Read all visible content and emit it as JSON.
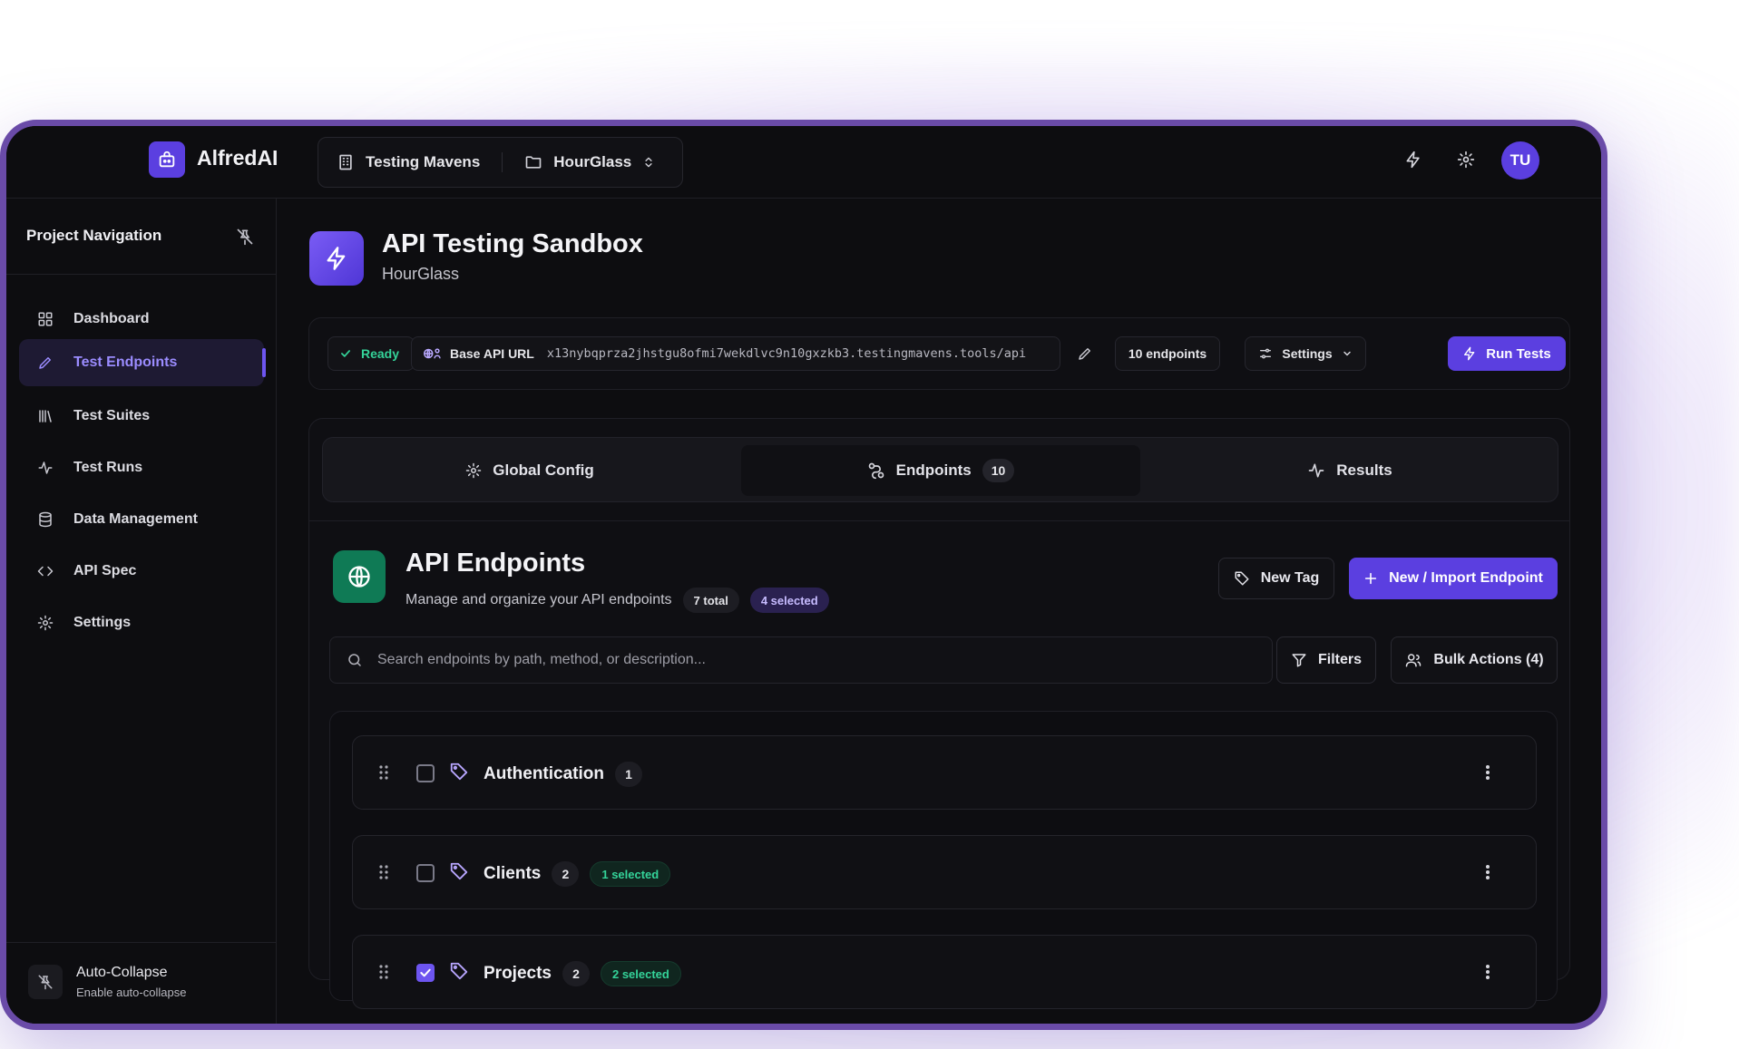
{
  "app": {
    "brand": "AlfredAI",
    "avatar_initials": "TU",
    "accent": "#5b3fe0"
  },
  "switcher": {
    "org": "Testing Mavens",
    "project": "HourGlass"
  },
  "sidebar": {
    "title": "Project Navigation",
    "items": [
      {
        "label": "Dashboard",
        "icon": "grid-icon"
      },
      {
        "label": "Test Endpoints",
        "icon": "pencil-icon",
        "active": true
      },
      {
        "label": "Test Suites",
        "icon": "library-icon"
      },
      {
        "label": "Test Runs",
        "icon": "activity-icon"
      },
      {
        "label": "Data Management",
        "icon": "database-icon"
      },
      {
        "label": "API Spec",
        "icon": "code-icon"
      },
      {
        "label": "Settings",
        "icon": "gear-icon"
      }
    ],
    "footer": {
      "title": "Auto-Collapse",
      "subtitle": "Enable auto-collapse"
    }
  },
  "project": {
    "title": "API Testing Sandbox",
    "subtitle": "HourGlass"
  },
  "status": {
    "ready": "Ready",
    "base_url_label": "Base API URL",
    "base_url": "x13nybqprza2jhstgu8ofmi7wekdlvc9n10gxzkb3.testingmavens.tools/api",
    "endpoints_count": "10 endpoints",
    "settings_label": "Settings",
    "run_label": "Run Tests"
  },
  "tabs": [
    {
      "label": "Global Config"
    },
    {
      "label": "Endpoints",
      "count": "10"
    },
    {
      "label": "Results"
    }
  ],
  "endpoints": {
    "title": "API Endpoints",
    "subtitle": "Manage and organize your API endpoints",
    "total": "7 total",
    "selected": "4 selected",
    "new_tag": "New Tag",
    "new_import": "New / Import Endpoint",
    "search_placeholder": "Search endpoints by path, method, or description...",
    "filters": "Filters",
    "bulk": "Bulk Actions (4)",
    "groups": [
      {
        "name": "Authentication",
        "count": "1",
        "selected": "",
        "checked": false
      },
      {
        "name": "Clients",
        "count": "2",
        "selected": "1 selected",
        "checked": false
      },
      {
        "name": "Projects",
        "count": "2",
        "selected": "2 selected",
        "checked": true
      }
    ]
  }
}
